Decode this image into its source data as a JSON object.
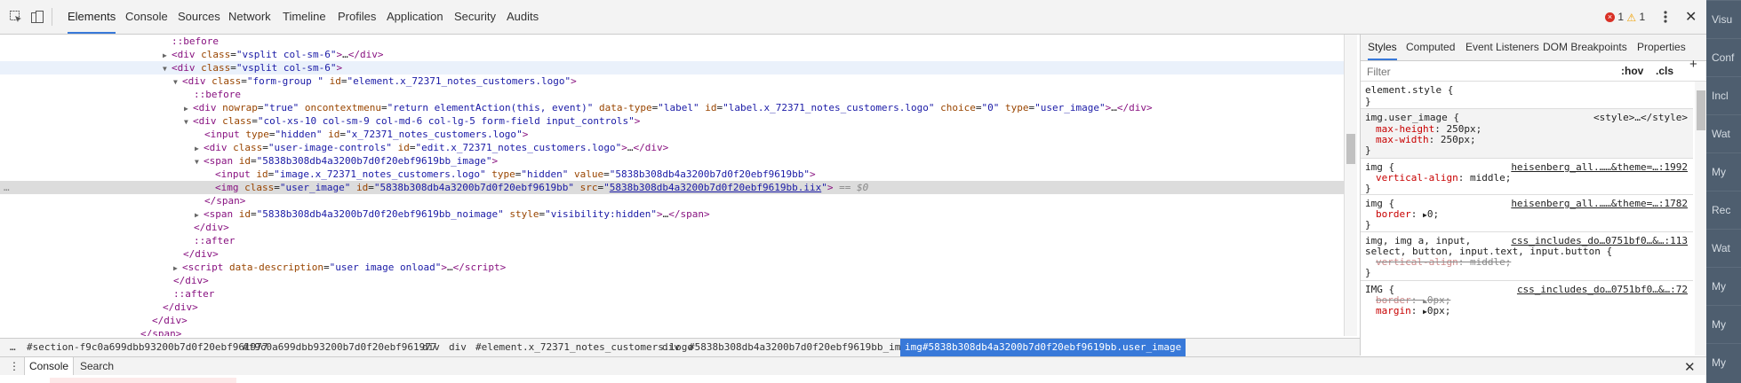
{
  "toolbar": {
    "tabs": [
      "Elements",
      "Console",
      "Sources",
      "Network",
      "Timeline",
      "Profiles",
      "Application",
      "Security",
      "Audits"
    ],
    "active_tab": "Elements",
    "error_count": "1",
    "warning_count": "1"
  },
  "tree": {
    "row1": "::before",
    "row2_class": "vsplit col-sm-6",
    "row3_class": "vsplit col-sm-6",
    "row4_class": "form-group ",
    "row4_id": "element.x_72371_notes_customers.logo",
    "row5": "::before",
    "row6_nowrap": "true",
    "row6_contextmenu": "return elementAction(this, event)",
    "row6_datatype": "label",
    "row6_id": "label.x_72371_notes_customers.logo",
    "row6_choice": "0",
    "row6_type": "user_image",
    "row7_class": "col-xs-10 col-sm-9 col-md-6 col-lg-5 form-field input_controls",
    "row8_type": "hidden",
    "row8_id": "x_72371_notes_customers.logo",
    "row9_class": "user-image-controls",
    "row9_id": "edit.x_72371_notes_customers.logo",
    "row10_id": "5838b308db4a3200b7d0f20ebf9619bb_image",
    "row11_id": "image.x_72371_notes_customers.logo",
    "row11_type": "hidden",
    "row11_value": "5838b308db4a3200b7d0f20ebf9619bb",
    "row12_class": "user_image",
    "row12_id": "5838b308db4a3200b7d0f20ebf9619bb",
    "row12_src": "5838b308db4a3200b7d0f20ebf9619bb.iix",
    "row12_eq": "== $0",
    "row13": "</span>",
    "row14_id": "5838b308db4a3200b7d0f20ebf9619bb_noimage",
    "row14_style": "visibility:hidden",
    "row15": "</div>",
    "row16": "::after",
    "row17": "</div>",
    "row18_desc": "user image onload",
    "row19": "</div>",
    "row20": "::after",
    "row21": "</div>",
    "row22": "</div>",
    "row23": "</span>"
  },
  "breadcrumbs": [
    "#section-f9c0a699dbb93200b7d0f20ebf961977",
    "#f9c0a699dbb93200b7d0f20ebf961977",
    "div",
    "div",
    "#element.x_72371_notes_customers.logo",
    "div",
    "#5838b308db4a3200b7d0f20ebf9619bb_image",
    "img#5838b308db4a3200b7d0f20ebf9619bb.user_image"
  ],
  "sidebar": {
    "tabs": [
      "Styles",
      "Computed",
      "Event Listeners",
      "DOM Breakpoints",
      "Properties"
    ],
    "filter_placeholder": "Filter",
    "hov": ":hov",
    "cls": ".cls",
    "add": "+",
    "rules": {
      "r1_sel": "element.style {",
      "r1_close": "}",
      "r2_sel": "img.user_image {",
      "r2_src": "<style>…</style>",
      "r2_p1n": "max-height",
      "r2_p1v": "250px;",
      "r2_p2n": "max-width",
      "r2_p2v": "250px;",
      "r2_close": "}",
      "r3_sel": "img {",
      "r3_src": "heisenberg_all.……&theme=…:1992",
      "r3_pn": "vertical-align",
      "r3_pv": "middle;",
      "r3_close": "}",
      "r4_sel": "img {",
      "r4_src": "heisenberg_all.……&theme=…:1782",
      "r4_pn": "border",
      "r4_pv": "0;",
      "r4_close": "}",
      "r5_sel1": "img, img a, input,",
      "r5_sel2": "select, button, input.text, input.button {",
      "r5_src": "css_includes_do…0751bf0…&…:113",
      "r5_pn": "vertical-align",
      "r5_pv": "middle;",
      "r5_close": "}",
      "r6_sel": "IMG {",
      "r6_src": "css_includes_do…0751bf0…&…:72",
      "r6_p1n": "border",
      "r6_p1v": "0px;",
      "r6_p2n": "margin",
      "r6_p2v": "0px;"
    }
  },
  "drawer": {
    "more": "⋮",
    "console": "Console",
    "search": "Search"
  },
  "app_nav": [
    "Visu",
    "Conf",
    "Incl",
    "Wat",
    "My",
    "Rec",
    "Wat",
    "My",
    "My",
    "My"
  ],
  "colors": {
    "accent": "#3879d9",
    "tag": "#881280",
    "attr_name": "#994500",
    "attr_value": "#1a1aa6",
    "css_prop": "#c80000"
  }
}
